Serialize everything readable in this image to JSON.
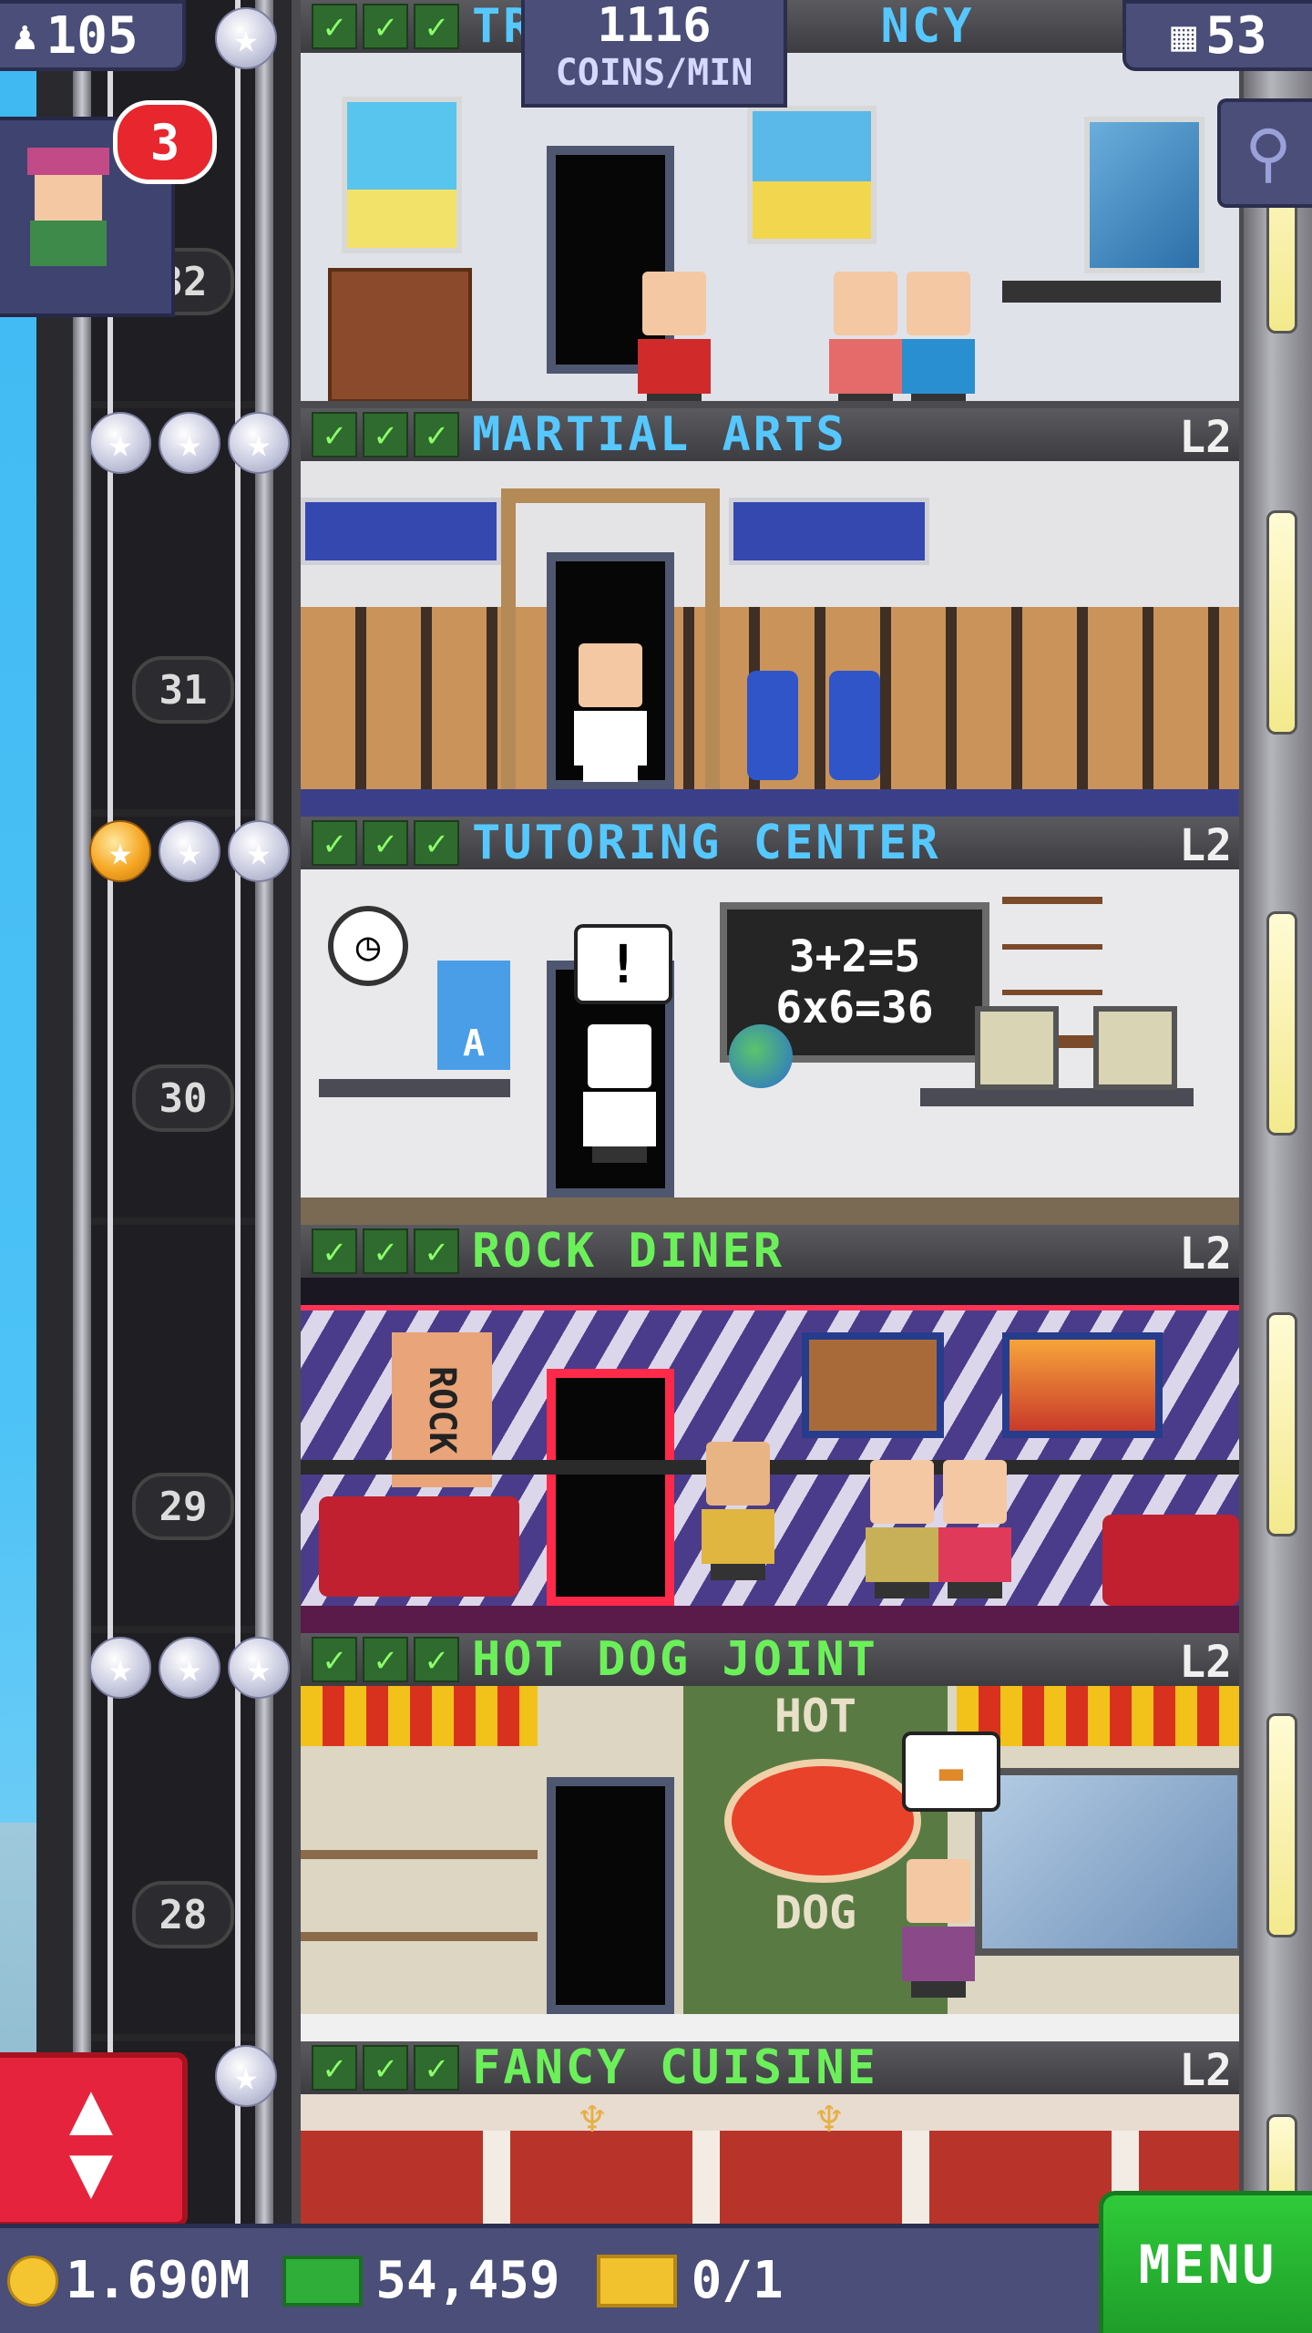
{
  "hud": {
    "population": "105",
    "coins_per_min_value": "1116",
    "coins_per_min_unit": "COINS/MIN",
    "floor_count": "53",
    "notification_count": "3"
  },
  "currency": {
    "coins": "1.690M",
    "bux": "54,459",
    "tickets": "0/1"
  },
  "menu_label": "MENU",
  "elevator_floor_numbers": [
    "32",
    "31",
    "30",
    "29",
    "28"
  ],
  "floors": [
    {
      "name": "TRAVEL AGENCY",
      "visible_name_left": "TR",
      "visible_name_right": "NCY",
      "level": "",
      "color": "#56c8ff",
      "checks": 3
    },
    {
      "name": "MARTIAL ARTS",
      "level": "L2",
      "color": "#56c8ff",
      "checks": 3
    },
    {
      "name": "TUTORING CENTER",
      "level": "L2",
      "color": "#56c8ff",
      "checks": 3,
      "chalkboard_line1": "3+2=5",
      "chalkboard_line2": "6x6=36",
      "poster_letter": "A",
      "bubble": "!"
    },
    {
      "name": "ROCK DINER",
      "level": "L2",
      "color": "#6cf05a",
      "checks": 3,
      "sign_text": "ROCK"
    },
    {
      "name": "HOT DOG JOINT",
      "level": "L2",
      "color": "#6cf05a",
      "checks": 3,
      "sign_top": "HOT",
      "sign_bottom": "DOG"
    },
    {
      "name": "FANCY CUISINE",
      "level": "L2",
      "color": "#6cf05a",
      "checks": 3
    }
  ],
  "colors": {
    "sky": "#3fb6f0",
    "hud": "#4a4e78",
    "menu_green": "#2fcb39",
    "elevator_button": "#e6233d",
    "badge": "#e8262d"
  },
  "icons": [
    "population-icon",
    "floors-icon",
    "zoom-icon",
    "coin-icon",
    "bux-icon",
    "ticket-icon",
    "elevator-arrows-icon",
    "star-icon",
    "check-icon"
  ]
}
